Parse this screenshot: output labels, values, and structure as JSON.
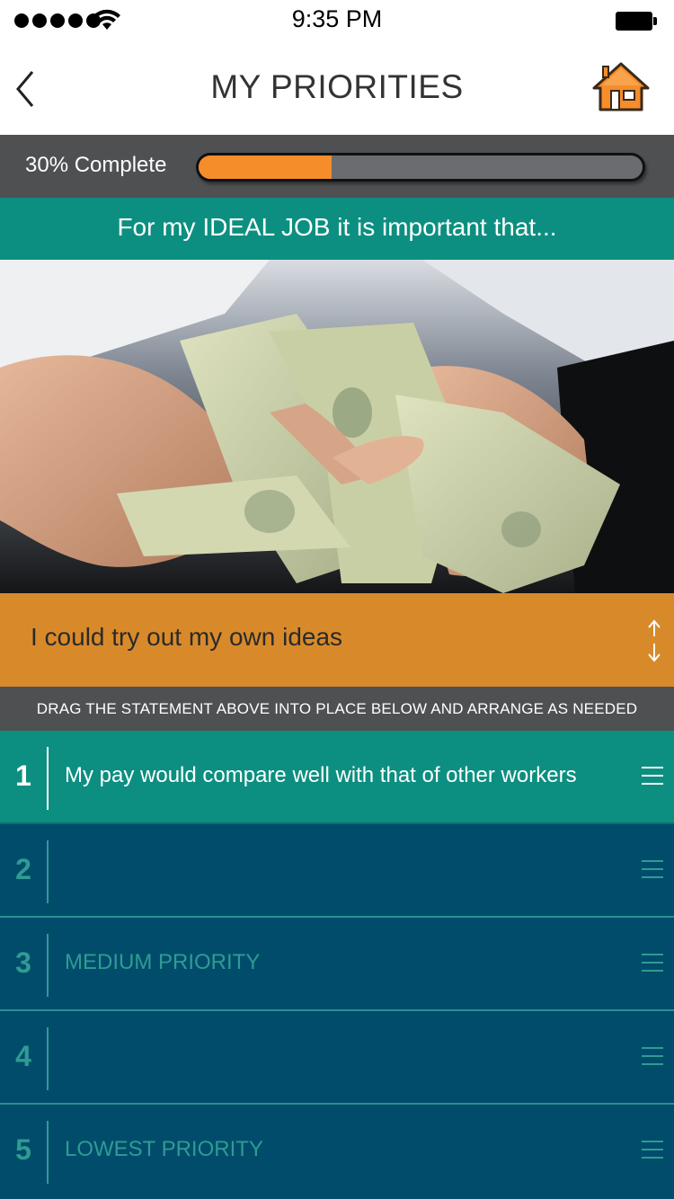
{
  "status_bar": {
    "time": "9:35 PM"
  },
  "nav": {
    "title": "MY PRIORITIES",
    "back_icon": "chevron-left-icon",
    "home_icon": "home-icon"
  },
  "progress": {
    "label": "30% Complete",
    "percent": 30
  },
  "prompt": {
    "text": "For my IDEAL JOB it is important that..."
  },
  "statement": {
    "text": "I could try out my own ideas"
  },
  "instruction": {
    "text": "DRAG THE STATEMENT ABOVE INTO PLACE BELOW AND ARRANGE AS NEEDED"
  },
  "priorities": [
    {
      "number": "1",
      "text": "My pay would compare well with that of other workers",
      "filled": true
    },
    {
      "number": "2",
      "text": "",
      "filled": false
    },
    {
      "number": "3",
      "text": "MEDIUM PRIORITY",
      "filled": false
    },
    {
      "number": "4",
      "text": "",
      "filled": false
    },
    {
      "number": "5",
      "text": "LOWEST PRIORITY",
      "filled": false
    }
  ],
  "colors": {
    "teal": "#0c8f80",
    "navy": "#014c6b",
    "orange": "#f68d2b",
    "statement_orange": "#d88a2a",
    "gray": "#4f5052"
  }
}
